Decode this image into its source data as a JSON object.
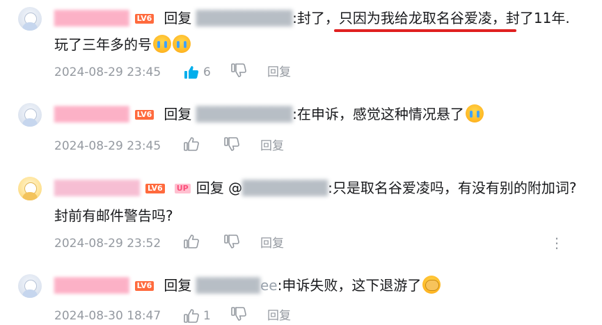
{
  "replies": [
    {
      "level_badge": "LV6",
      "reply_word": "回复",
      "content": ":封了，只因为我给龙取名谷爱凌，封了11年.",
      "content_line2": "玩了三年多的号",
      "time": "2024-08-29 23:45",
      "like_count": "6",
      "reply_label": "回复",
      "liked": true
    },
    {
      "level_badge": "LV6",
      "reply_word": "回复",
      "content": ":在申诉，感觉这种情况悬了",
      "time": "2024-08-29 23:45",
      "reply_label": "回复"
    },
    {
      "level_badge": "LV6",
      "up_badge": "UP",
      "reply_word": "回复 @",
      "content": ":只是取名谷爱凌吗，有没有别的附加词?",
      "content_line2": "封前有邮件警告吗?",
      "time": "2024-08-29 23:52",
      "reply_label": "回复",
      "more": "⋮"
    },
    {
      "level_badge": "LV6",
      "reply_word": "回复",
      "target_suffix": "ee",
      "content": ":申诉失败，这下退游了",
      "time": "2024-08-30 18:47",
      "like_count": "1",
      "reply_label": "回复"
    }
  ],
  "colors": {
    "accent_like": "#00aeec",
    "meta_gray": "#9499a0",
    "underline_red": "#e02020",
    "level_badge": "#ff6a3d"
  }
}
